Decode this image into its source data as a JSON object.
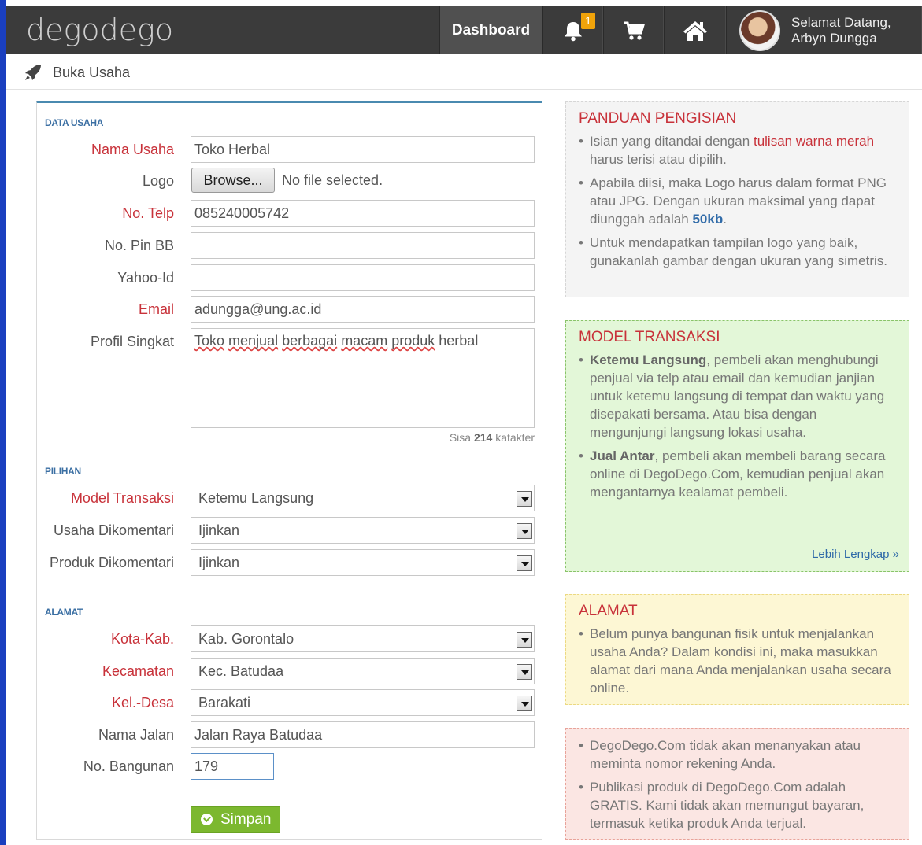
{
  "app": {
    "logo": "degodego"
  },
  "nav": {
    "dashboard": "Dashboard",
    "notif_count": "1",
    "welcome_line1": "Selamat Datang,",
    "welcome_line2": "Arbyn Dungga"
  },
  "breadcrumb": {
    "label": "Buka Usaha"
  },
  "form": {
    "sections": {
      "data_usaha": "DATA USAHA",
      "pilihan": "PILIHAN",
      "alamat": "ALAMAT"
    },
    "nama_usaha": {
      "label": "Nama Usaha",
      "value": "Toko Herbal"
    },
    "logo": {
      "label": "Logo",
      "button": "Browse...",
      "status": "No file selected."
    },
    "no_telp": {
      "label": "No. Telp",
      "value": "085240005742"
    },
    "pin_bb": {
      "label": "No. Pin BB",
      "value": ""
    },
    "yahoo_id": {
      "label": "Yahoo-Id",
      "value": ""
    },
    "email": {
      "label": "Email",
      "value": "adungga@ung.ac.id"
    },
    "profil": {
      "label": "Profil Singkat",
      "words": [
        "Toko",
        "menjual",
        "berbagai",
        "macam",
        "produk"
      ],
      "tail": "herbal"
    },
    "counter": {
      "prefix": "Sisa",
      "count": "214",
      "suffix": "katakter"
    },
    "model_transaksi": {
      "label": "Model Transaksi",
      "value": "Ketemu Langsung"
    },
    "usaha_dikomentari": {
      "label": "Usaha Dikomentari",
      "value": "Ijinkan"
    },
    "produk_dikomentari": {
      "label": "Produk Dikomentari",
      "value": "Ijinkan"
    },
    "kota_kab": {
      "label": "Kota-Kab.",
      "value": "Kab. Gorontalo"
    },
    "kecamatan": {
      "label": "Kecamatan",
      "value": "Kec. Batudaa"
    },
    "kel_desa": {
      "label": "Kel.-Desa",
      "value": "Barakati"
    },
    "nama_jalan": {
      "label": "Nama Jalan",
      "value": "Jalan Raya Batudaa"
    },
    "no_bangunan": {
      "label": "No. Bangunan",
      "value": "179"
    },
    "save_label": "Simpan"
  },
  "panels": {
    "guide": {
      "title": "PANDUAN PENGISIAN",
      "item1_pre": "Isian yang ditandai dengan",
      "item1_red": "tulisan warna merah",
      "item1_post": "harus terisi atau dipilih.",
      "item2_pre": "Apabila diisi, maka Logo harus dalam format PNG atau JPG. Dengan ukuran maksimal yang dapat diunggah adalah",
      "item2_blue": "50kb",
      "item2_post": ".",
      "item3": "Untuk mendapatkan tampilan logo yang baik, gunakanlah gambar dengan ukuran yang simetris."
    },
    "model": {
      "title": "MODEL TRANSAKSI",
      "item1_bold": "Ketemu Langsung",
      "item1_text": ", pembeli akan menghubungi penjual via telp atau email dan kemudian janjian untuk ketemu langsung di tempat dan waktu yang disepakati bersama. Atau bisa dengan mengunjungi langsung lokasi usaha.",
      "item2_bold": "Jual Antar",
      "item2_text": ", pembeli akan membeli barang secara online di DegoDego.Com, kemudian penjual akan mengantarnya kealamat pembeli.",
      "more": "Lebih Lengkap »"
    },
    "alamat": {
      "title": "ALAMAT",
      "item1": "Belum punya bangunan fisik untuk menjalankan usaha Anda? Dalam kondisi ini, maka masukkan alamat dari mana Anda menjalankan usaha secara online."
    },
    "warning": {
      "item1": "DegoDego.Com tidak akan menanyakan atau meminta nomor rekening Anda.",
      "item2": "Publikasi produk di DegoDego.Com adalah GRATIS. Kami tidak akan memungut bayaran, termasuk ketika produk Anda terjual."
    }
  }
}
